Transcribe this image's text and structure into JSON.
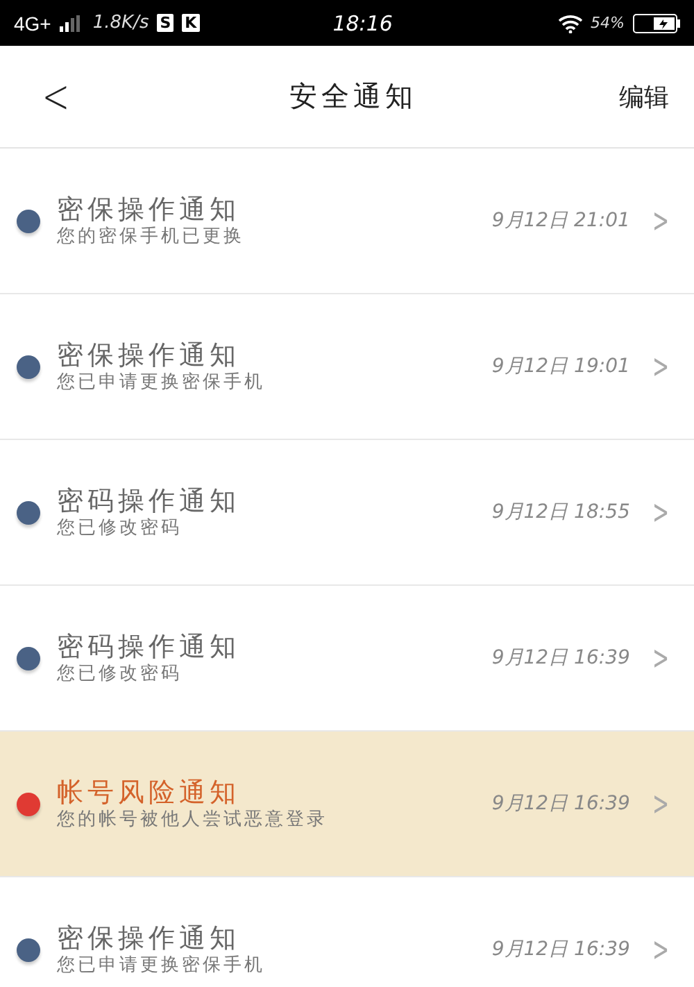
{
  "status_bar": {
    "network": "4G+",
    "speed": "1.8K/s",
    "app_badges": [
      "S",
      "K"
    ],
    "time": "18:16",
    "battery": "54%"
  },
  "nav_bar": {
    "back": "<",
    "title": "安全通知",
    "edit": "编辑"
  },
  "notifications": [
    {
      "kind": "normal",
      "color": "#4a6285",
      "title": "密保操作通知",
      "message": "您的密保手机已更换",
      "time": "9月12日 21:01",
      "chevron": ">"
    },
    {
      "kind": "normal",
      "color": "#4a6285",
      "title": "密保操作通知",
      "message": "您已申请更换密保手机",
      "time": "9月12日 19:01",
      "chevron": ">"
    },
    {
      "kind": "normal",
      "color": "#4a6285",
      "title": "密码操作通知",
      "message": "您已修改密码",
      "time": "9月12日 18:55",
      "chevron": ">"
    },
    {
      "kind": "normal",
      "color": "#4a6285",
      "title": "密码操作通知",
      "message": "您已修改密码",
      "time": "9月12日 16:39",
      "chevron": ">"
    },
    {
      "kind": "risk",
      "color": "#e03a33",
      "title": "帐号风险通知",
      "message": "您的帐号被他人尝试恶意登录",
      "time": "9月12日 16:39",
      "chevron": ">"
    },
    {
      "kind": "normal",
      "color": "#4a6285",
      "title": "密保操作通知",
      "message": "您已申请更换密保手机",
      "time": "9月12日 16:39",
      "chevron": ">"
    }
  ]
}
